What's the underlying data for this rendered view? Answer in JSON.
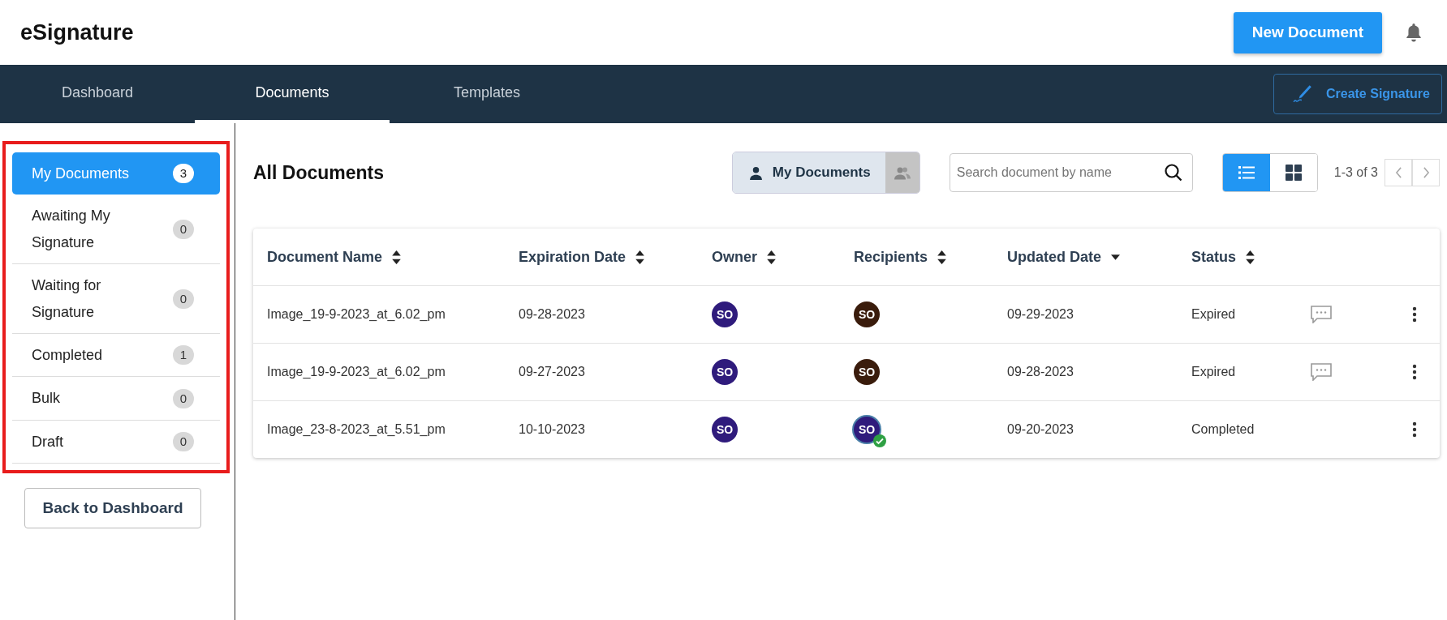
{
  "app": {
    "title": "eSignature"
  },
  "header": {
    "new_button": "New Document"
  },
  "nav": {
    "tabs": [
      {
        "label": "Dashboard",
        "selected": false
      },
      {
        "label": "Documents",
        "selected": true
      },
      {
        "label": "Templates",
        "selected": false
      }
    ],
    "create_signature": "Create Signature"
  },
  "sidebar": {
    "highlighted": true,
    "items": [
      {
        "label": "My Documents",
        "count": "3",
        "selected": true
      },
      {
        "label": "Awaiting My Signature",
        "count": "0",
        "selected": false
      },
      {
        "label": "Waiting for Signature",
        "count": "0",
        "selected": false
      },
      {
        "label": "Completed",
        "count": "1",
        "selected": false
      },
      {
        "label": "Bulk",
        "count": "0",
        "selected": false
      },
      {
        "label": "Draft",
        "count": "0",
        "selected": false
      }
    ],
    "back_button": "Back to Dashboard"
  },
  "main": {
    "title": "All Documents",
    "owner_filter": [
      {
        "kind": "single",
        "label": "My Documents",
        "selected": true
      },
      {
        "kind": "group",
        "selected": false
      }
    ],
    "search": {
      "placeholder": "Search document by name"
    },
    "views": [
      {
        "kind": "list",
        "selected": true
      },
      {
        "kind": "grid",
        "selected": false
      }
    ],
    "pagination": "1-3 of 3"
  },
  "table": {
    "columns": [
      {
        "label": "Document Name",
        "kind": "sortable"
      },
      {
        "label": "Expiration Date",
        "kind": "sortable"
      },
      {
        "label": "Owner",
        "kind": "sortable"
      },
      {
        "label": "Recipients",
        "kind": "sortable"
      },
      {
        "label": "Updated Date",
        "kind": "sorted"
      },
      {
        "label": "Status",
        "kind": "sortable"
      }
    ],
    "rows": [
      {
        "name": "Image_19-9-2023_at_6.02_pm",
        "expiration": "09-28-2023",
        "owner": {
          "initials": "SO",
          "color": "#2f1b7c"
        },
        "recipient": {
          "initials": "SO",
          "color": "#3a1c0c",
          "signed": false
        },
        "updated": "09-29-2023",
        "status": "Expired",
        "has_comments": true
      },
      {
        "name": "Image_19-9-2023_at_6.02_pm",
        "expiration": "09-27-2023",
        "owner": {
          "initials": "SO",
          "color": "#2f1b7c"
        },
        "recipient": {
          "initials": "SO",
          "color": "#3a1c0c",
          "signed": false
        },
        "updated": "09-28-2023",
        "status": "Expired",
        "has_comments": true
      },
      {
        "name": "Image_23-8-2023_at_5.51_pm",
        "expiration": "10-10-2023",
        "owner": {
          "initials": "SO",
          "color": "#2f1b7c"
        },
        "recipient": {
          "initials": "SO",
          "color": "#2f1b7c",
          "signed": true
        },
        "updated": "09-20-2023",
        "status": "Completed",
        "has_comments": false
      }
    ]
  }
}
